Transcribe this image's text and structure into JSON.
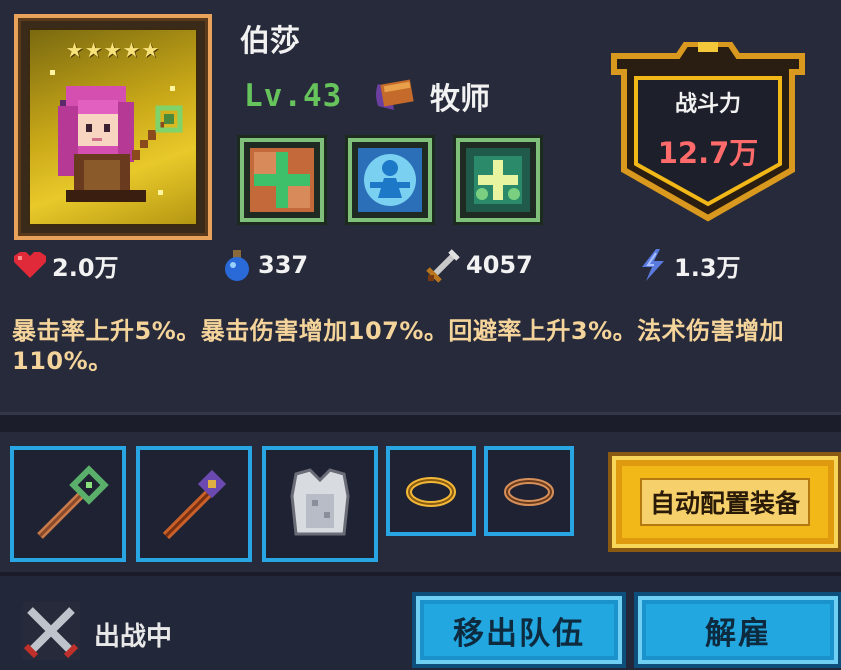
{
  "hero": {
    "stars": "★★★★★",
    "name": "伯莎",
    "level": "Lv.43",
    "class_name": "牧师"
  },
  "power": {
    "title": "战斗力",
    "value": "12.7万"
  },
  "skills": [
    {
      "icon": "heal-cross-icon"
    },
    {
      "icon": "figure-aura-icon"
    },
    {
      "icon": "group-heal-icon"
    }
  ],
  "stats": {
    "hp": "2.0万",
    "mana": "337",
    "attack": "4057",
    "speed": "1.3万"
  },
  "description": "暴击率上升5%。暴击伤害增加107%。回避率上升3%。法术伤害增加110%。",
  "equipment": {
    "slots": [
      {
        "icon": "green-staff-icon"
      },
      {
        "icon": "purple-staff-icon"
      },
      {
        "icon": "armor-icon"
      },
      {
        "icon": "gold-ring-icon"
      },
      {
        "icon": "bronze-ring-icon"
      }
    ],
    "auto_equip_label": "自动配置装备"
  },
  "bottom": {
    "status_label": "出战中",
    "remove_label": "移出队伍",
    "dismiss_label": "解雇"
  },
  "colors": {
    "level_green": "#67c45c",
    "power_red": "#ff6b6b",
    "desc_gold": "#f4d49a",
    "button_blue": "#23a7e0",
    "button_gold": "#f2b818"
  }
}
